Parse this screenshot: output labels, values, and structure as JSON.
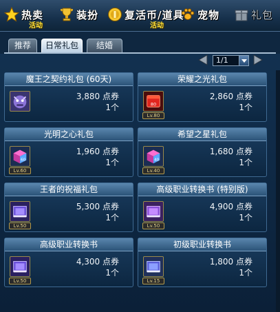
{
  "nav": {
    "hot": {
      "label": "热卖",
      "sub": "活动"
    },
    "outfit": {
      "label": "装扮"
    },
    "revive": {
      "label": "复活币/道具",
      "sub": "活动"
    },
    "pet": {
      "label": "宠物"
    },
    "gift": {
      "label": "礼包"
    }
  },
  "tabs": [
    "推荐",
    "日常礼包",
    "结婚"
  ],
  "pager": {
    "value": "1/1"
  },
  "items": [
    {
      "title": "魔王之契约礼包 (60天)",
      "price": "3,880 点券",
      "qty": "1个",
      "icon": "purple-creature-icon",
      "level": ""
    },
    {
      "title": "荣耀之光礼包",
      "price": "2,860 点券",
      "qty": "1个",
      "icon": "red-box-icon",
      "level": "Lv.80"
    },
    {
      "title": "光明之心礼包",
      "price": "1,960 点券",
      "qty": "1个",
      "icon": "pink-blue-box-icon",
      "level": "Lv.60"
    },
    {
      "title": "希望之星礼包",
      "price": "1,680 点券",
      "qty": "1个",
      "icon": "pink-blue-box-icon",
      "level": "Lv.40"
    },
    {
      "title": "王者的祝福礼包",
      "price": "5,300 点券",
      "qty": "1个",
      "icon": "book-icon",
      "level": "Lv.50"
    },
    {
      "title": "高级职业转换书 (特别版)",
      "price": "4,900 点券",
      "qty": "1个",
      "icon": "book-icon",
      "level": "Lv.50"
    },
    {
      "title": "高级职业转换书",
      "price": "4,300 点券",
      "qty": "1个",
      "icon": "book-icon",
      "level": "Lv.50"
    },
    {
      "title": "初级职业转换书",
      "price": "1,800 点券",
      "qty": "1个",
      "icon": "book-icon",
      "level": "Lv.15"
    }
  ]
}
